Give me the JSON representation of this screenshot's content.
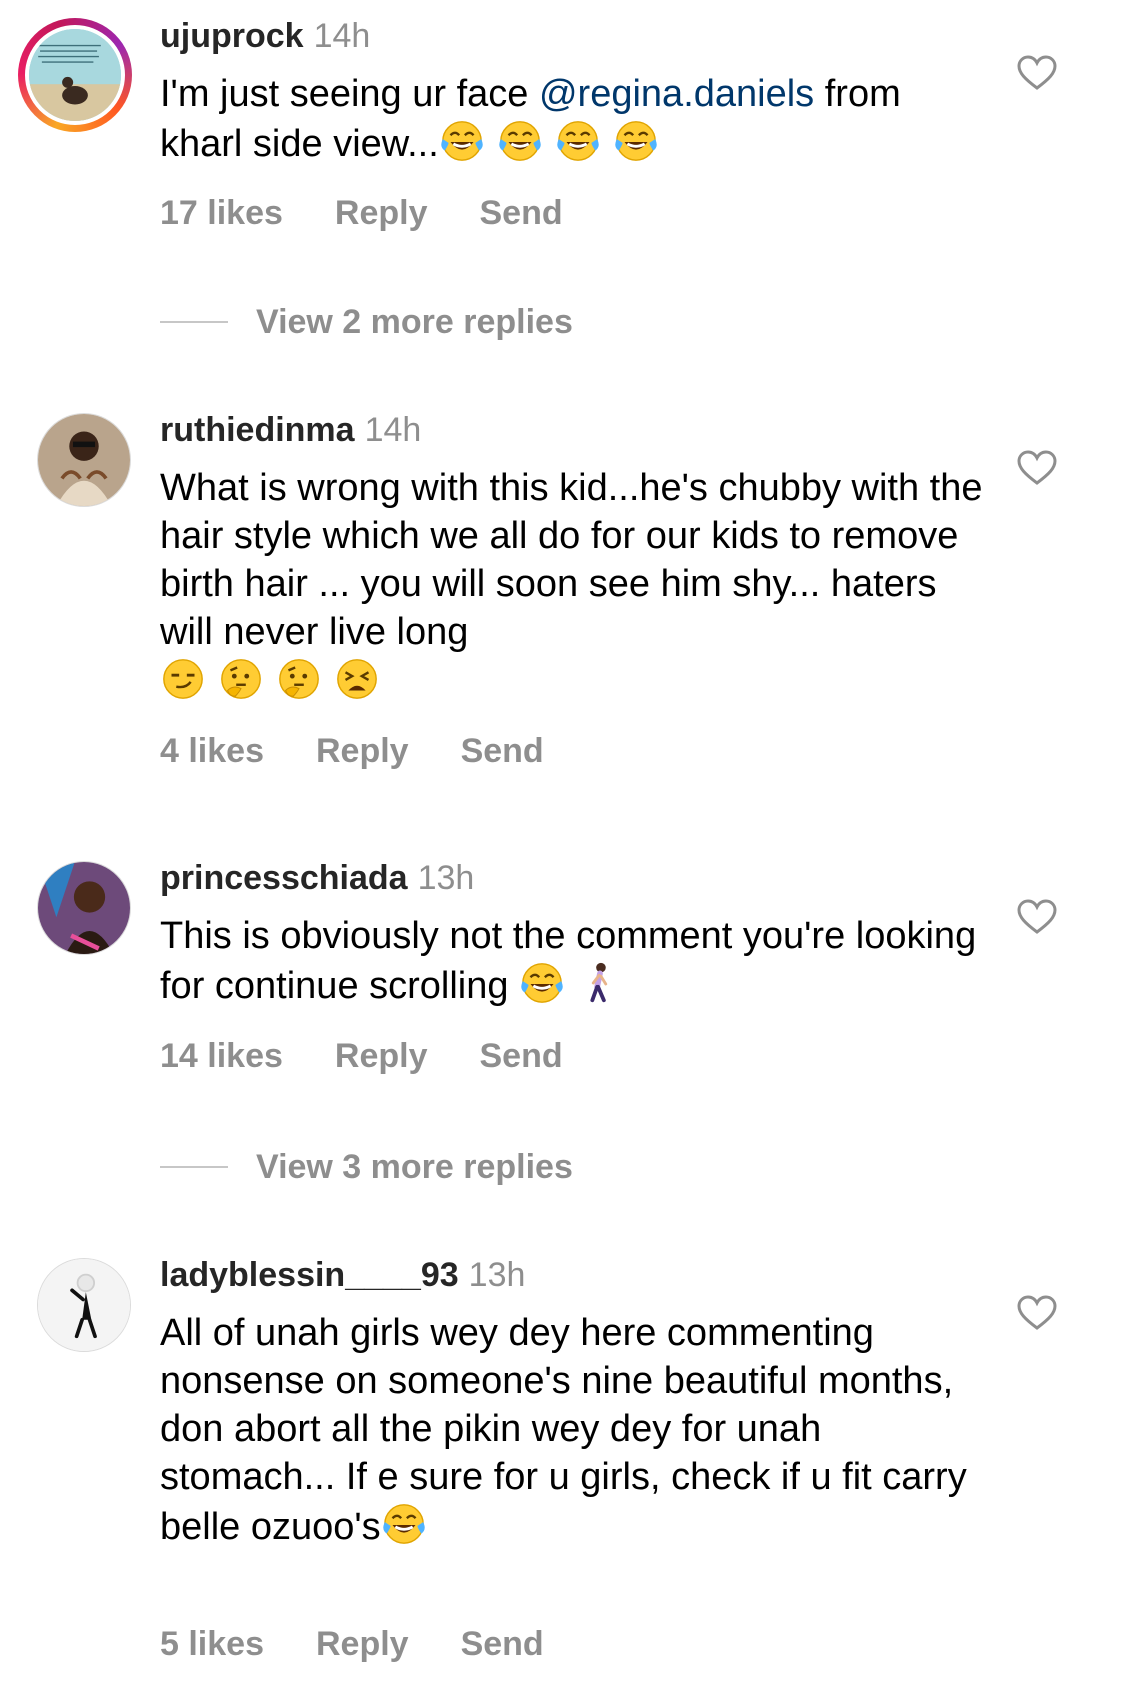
{
  "comments": [
    {
      "username": "ujuprock",
      "time": "14h",
      "text_before": "I'm just seeing ur face ",
      "mention": "@regina.daniels",
      "text_after": " from kharl side view...",
      "emojis": [
        "tears-of-joy",
        "tears-of-joy",
        "tears-of-joy",
        "tears-of-joy"
      ],
      "likes": "17 likes",
      "reply": "Reply",
      "send": "Send",
      "view_replies": "View 2 more replies"
    },
    {
      "username": "ruthiedinma",
      "time": "14h",
      "text": "What is wrong with this kid...he's chubby with the hair style which we all do for our kids to remove birth hair ... you will soon see him shy... haters will never live long",
      "emojis": [
        "smirking-face",
        "thinking-face",
        "thinking-face",
        "tired-face"
      ],
      "likes": "4 likes",
      "reply": "Reply",
      "send": "Send"
    },
    {
      "username": "princesschiada",
      "time": "13h",
      "text": "This is obviously not the comment you're looking for continue scrolling ",
      "emojis": [
        "tears-of-joy",
        "woman-walking"
      ],
      "likes": "14 likes",
      "reply": "Reply",
      "send": "Send",
      "view_replies": "View 3 more replies"
    },
    {
      "username": "ladyblessin____93",
      "time": "13h",
      "text": "All of unah girls wey dey here commenting nonsense on someone's nine beautiful months, don abort all the pikin wey dey for unah stomach... If e sure for u girls, check if u fit carry belle ozuoo's",
      "emojis": [
        "tears-of-joy"
      ],
      "likes": "5 likes",
      "reply": "Reply",
      "send": "Send"
    }
  ],
  "icons": {
    "like": "heart-outline-icon"
  },
  "colors": {
    "mention": "#00376b",
    "meta": "#8e8e8e",
    "story_ring": "#e91e63"
  }
}
